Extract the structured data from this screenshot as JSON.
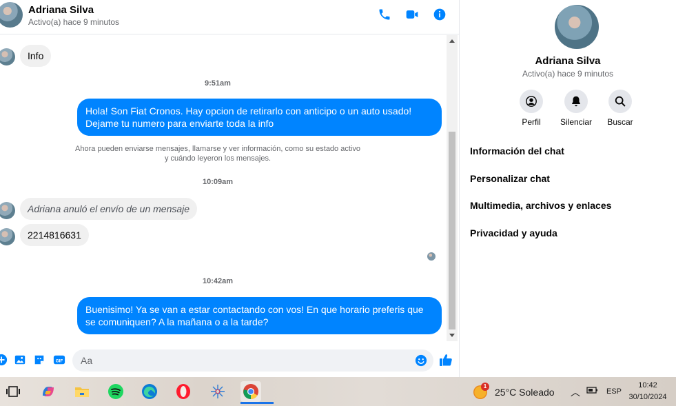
{
  "contact": {
    "name": "Adriana Silva",
    "status": "Activo(a) hace 9 minutos"
  },
  "colors": {
    "accent": "#0084ff",
    "bubble_in": "#f0f0f0",
    "icon_blue": "#0084ff"
  },
  "header": {
    "icons": [
      "phone-icon",
      "video-icon",
      "info-icon"
    ]
  },
  "messages": {
    "m1": "Info",
    "t1": "9:51am",
    "m2": "Hola! Son Fiat Cronos. Hay opcion de retirarlo con anticipo o un auto usado! Dejame tu numero para enviarte toda la info",
    "notice_line1": "Ahora pueden enviarse mensajes, llamarse y ver información, como su estado activo",
    "notice_line2": "y cuándo leyeron los mensajes.",
    "t2": "10:09am",
    "m3": "Adriana anuló el envío de un mensaje",
    "m4": "2214816631",
    "t3": "10:42am",
    "m5": "Buenisimo! Ya se van a estar contactando con vos! En que horario preferis que se comuniquen? A la mañana o a la tarde?"
  },
  "composer": {
    "placeholder": "Aa",
    "icons": [
      "plus-icon",
      "image-icon",
      "sticker-icon",
      "gif-icon",
      "emoji-icon",
      "like-icon"
    ],
    "gif_label": "GIF"
  },
  "panel": {
    "actions": [
      {
        "label": "Perfil",
        "icon": "profile-icon"
      },
      {
        "label": "Silenciar",
        "icon": "bell-icon"
      },
      {
        "label": "Buscar",
        "icon": "search-icon"
      }
    ],
    "menu": [
      "Información del chat",
      "Personalizar chat",
      "Multimedia, archivos y enlaces",
      "Privacidad y ayuda"
    ]
  },
  "taskbar": {
    "apps": [
      "task-view",
      "copilot",
      "file-explorer",
      "spotify",
      "edge",
      "opera",
      "capcut",
      "chrome"
    ],
    "weather": "25°C  Soleado",
    "weather_badge": "1",
    "language": "ESP",
    "time": "10:42",
    "date": "30/10/2024"
  }
}
